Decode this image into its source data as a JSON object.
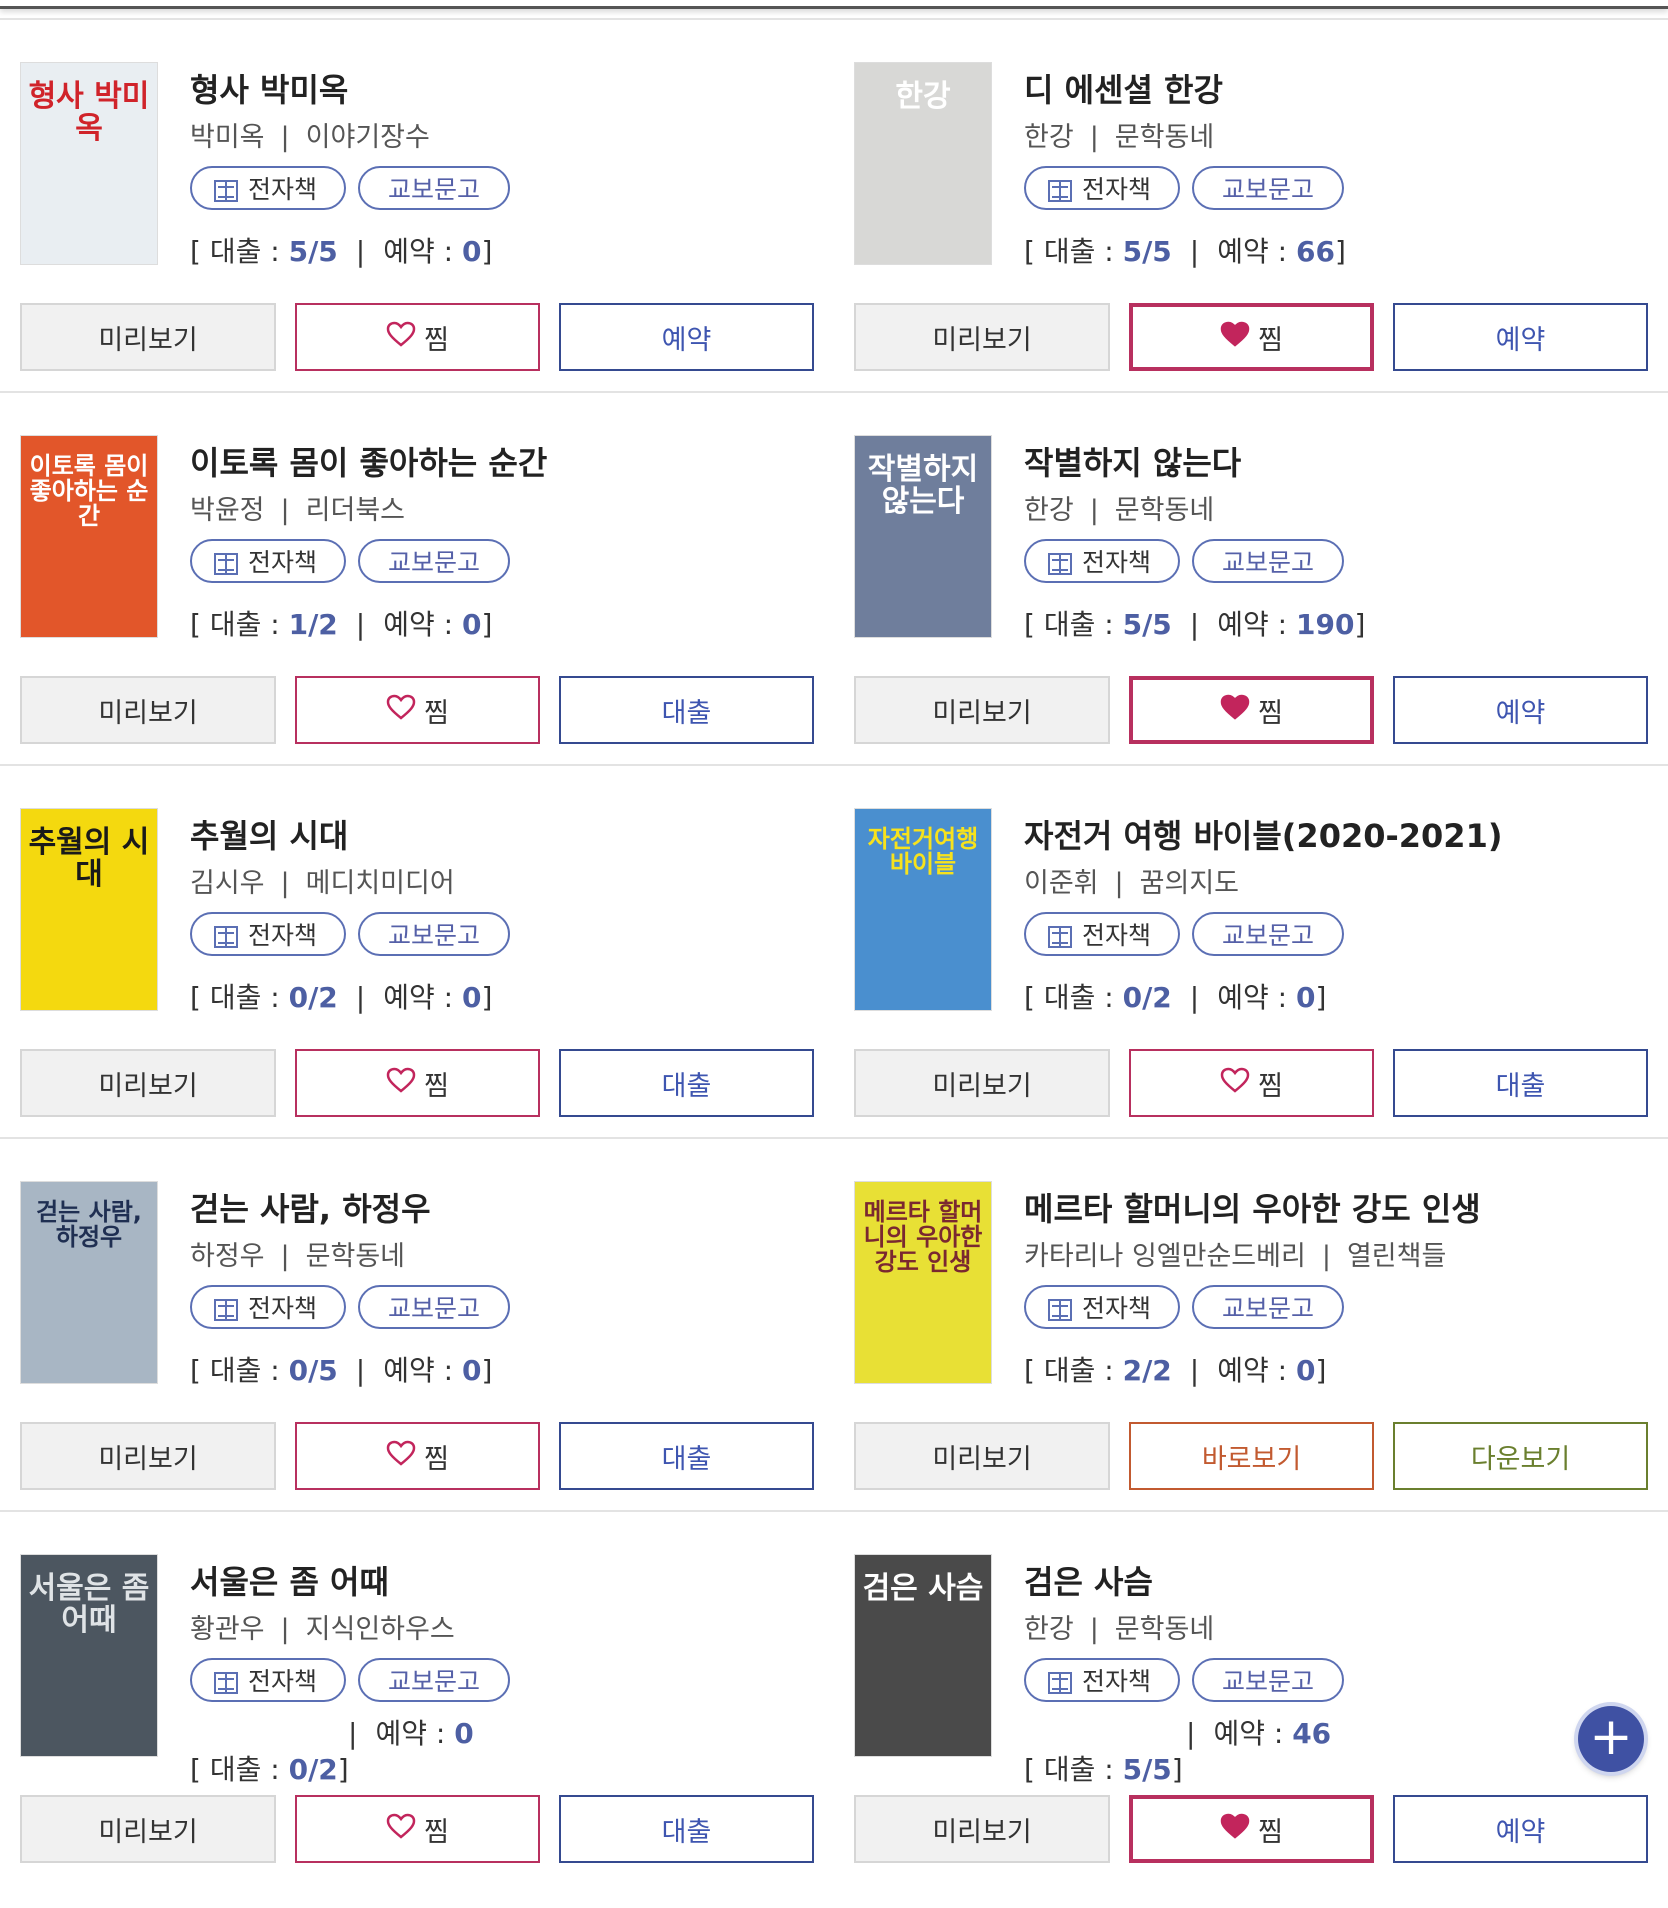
{
  "labels": {
    "ebook": "전자책",
    "kyobo": "교보문고",
    "loan_prefix": "[ 대출 : ",
    "reserve_prefix": "예약 : ",
    "close": "]",
    "pipe": "|",
    "preview": "미리보기",
    "wish": "찜",
    "read": "바로보기",
    "download": "다운보기"
  },
  "colors": {
    "accent": "#4d5fa3",
    "wish": "#b8305f",
    "heart_fill": "#c2255c"
  },
  "books": [
    {
      "title": "형사 박미옥",
      "author": "박미옥",
      "publisher": "이야기장수",
      "loan": "5/5",
      "reserve": "0",
      "wished": false,
      "action": "예약",
      "cover_text": "형사 박미옥",
      "cover_bg": "#e9eef2",
      "cover_fg": "#d0232a"
    },
    {
      "title": "디 에센셜 한강",
      "author": "한강",
      "publisher": "문학동네",
      "loan": "5/5",
      "reserve": "66",
      "wished": true,
      "action": "예약",
      "cover_text": "한강",
      "cover_bg": "#d8d8d6",
      "cover_fg": "#ffffff"
    },
    {
      "title": "이토록 몸이 좋아하는 순간",
      "author": "박윤정",
      "publisher": "리더북스",
      "loan": "1/2",
      "reserve": "0",
      "wished": false,
      "action": "대출",
      "cover_text": "이토록 몸이 좋아하는 순간",
      "cover_bg": "#e2562a",
      "cover_fg": "#ffffff"
    },
    {
      "title": "작별하지 않는다",
      "author": "한강",
      "publisher": "문학동네",
      "loan": "5/5",
      "reserve": "190",
      "wished": true,
      "action": "예약",
      "cover_text": "작별하지 않는다",
      "cover_bg": "#6f7e9c",
      "cover_fg": "#ffffff"
    },
    {
      "title": "추월의 시대",
      "author": "김시우",
      "publisher": "메디치미디어",
      "loan": "0/2",
      "reserve": "0",
      "wished": false,
      "action": "대출",
      "cover_text": "추월의 시대",
      "cover_bg": "#f4d90f",
      "cover_fg": "#1a1a1a"
    },
    {
      "title": "자전거 여행 바이블(2020-2021)",
      "author": "이준휘",
      "publisher": "꿈의지도",
      "loan": "0/2",
      "reserve": "0",
      "wished": false,
      "action": "대출",
      "cover_text": "자전거여행 바이블",
      "cover_bg": "#4a8fcf",
      "cover_fg": "#f7e21c"
    },
    {
      "title": "걷는 사람, 하정우",
      "author": "하정우",
      "publisher": "문학동네",
      "loan": "0/5",
      "reserve": "0",
      "wished": false,
      "action": "대출",
      "cover_text": "걷는 사람, 하정우",
      "cover_bg": "#a8b6c4",
      "cover_fg": "#1f2f52"
    },
    {
      "title": "메르타 할머니의 우아한 강도 인생",
      "author": "카타리나 잉엘만순드베리",
      "publisher": "열린책들",
      "loan": "2/2",
      "reserve": "0",
      "wished": false,
      "action": null,
      "cover_text": "메르타 할머니의 우아한 강도 인생",
      "cover_bg": "#e8e035",
      "cover_fg": "#7a2830"
    },
    {
      "title": "서울은 좀 어때",
      "author": "황관우",
      "publisher": "지식인하우스",
      "loan": "0/2",
      "reserve": "0",
      "wished": false,
      "action": "대출",
      "cover_text": "서울은 좀 어때",
      "cover_bg": "#4c5660",
      "cover_fg": "#dfe3e6"
    },
    {
      "title": "검은 사슴",
      "author": "한강",
      "publisher": "문학동네",
      "loan": "5/5",
      "reserve": "46",
      "wished": true,
      "action": "예약",
      "cover_text": "검은 사슴",
      "cover_bg": "#4a4a4a",
      "cover_fg": "#ffffff"
    }
  ]
}
